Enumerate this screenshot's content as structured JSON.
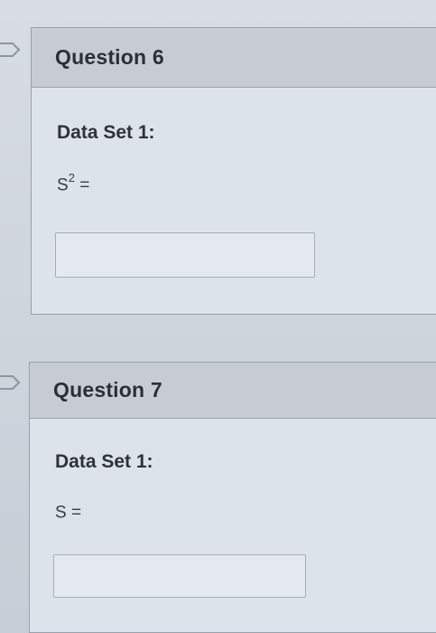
{
  "questions": [
    {
      "title": "Question 6",
      "dataset_label": "Data Set 1:",
      "formula_var": "S",
      "formula_sup": "2",
      "formula_eq": " ="
    },
    {
      "title": "Question 7",
      "dataset_label": "Data Set 1:",
      "formula_var": "S",
      "formula_sup": "",
      "formula_eq": " ="
    }
  ],
  "answers": [
    "",
    ""
  ]
}
